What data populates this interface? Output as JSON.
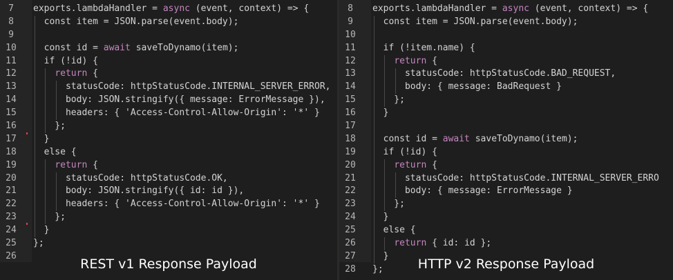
{
  "left": {
    "caption": "REST v1 Response Payload",
    "lines": [
      {
        "n": "7",
        "code": "exports.lambdaHandler = async (event, context) => {"
      },
      {
        "n": "8",
        "code": "  const item = JSON.parse(event.body);"
      },
      {
        "n": "9",
        "code": ""
      },
      {
        "n": "10",
        "code": "  const id = await saveToDynamo(item);"
      },
      {
        "n": "11",
        "code": "  if (!id) {"
      },
      {
        "n": "12",
        "code": "    return {"
      },
      {
        "n": "13",
        "code": "      statusCode: httpStatusCode.INTERNAL_SERVER_ERROR,"
      },
      {
        "n": "14",
        "code": "      body: JSON.stringify({ message: ErrorMessage }),"
      },
      {
        "n": "15",
        "code": "      headers: { 'Access-Control-Allow-Origin': '*' }"
      },
      {
        "n": "16",
        "code": "    };"
      },
      {
        "n": "17",
        "code": "  }"
      },
      {
        "n": "18",
        "code": "  else {"
      },
      {
        "n": "19",
        "code": "    return {"
      },
      {
        "n": "20",
        "code": "      statusCode: httpStatusCode.OK,"
      },
      {
        "n": "21",
        "code": "      body: JSON.stringify({ id: id }),"
      },
      {
        "n": "22",
        "code": "      headers: { 'Access-Control-Allow-Origin': '*' }"
      },
      {
        "n": "23",
        "code": "    };"
      },
      {
        "n": "24",
        "code": "  }"
      },
      {
        "n": "25",
        "code": "};"
      },
      {
        "n": "26",
        "code": ""
      }
    ]
  },
  "right": {
    "caption": "HTTP v2 Response Payload",
    "lines": [
      {
        "n": "8",
        "code": "exports.lambdaHandler = async (event, context) => {"
      },
      {
        "n": "9",
        "code": "  const item = JSON.parse(event.body);"
      },
      {
        "n": "10",
        "code": ""
      },
      {
        "n": "11",
        "code": "  if (!item.name) {"
      },
      {
        "n": "12",
        "code": "    return {"
      },
      {
        "n": "13",
        "code": "      statusCode: httpStatusCode.BAD_REQUEST,"
      },
      {
        "n": "14",
        "code": "      body: { message: BadRequest }"
      },
      {
        "n": "15",
        "code": "    };"
      },
      {
        "n": "16",
        "code": "  }"
      },
      {
        "n": "17",
        "code": ""
      },
      {
        "n": "18",
        "code": "  const id = await saveToDynamo(item);"
      },
      {
        "n": "19",
        "code": "  if (!id) {"
      },
      {
        "n": "20",
        "code": "    return {"
      },
      {
        "n": "21",
        "code": "      statusCode: httpStatusCode.INTERNAL_SERVER_ERRO"
      },
      {
        "n": "22",
        "code": "      body: { message: ErrorMessage }"
      },
      {
        "n": "23",
        "code": "    };"
      },
      {
        "n": "24",
        "code": "  }"
      },
      {
        "n": "25",
        "code": "  else {"
      },
      {
        "n": "26",
        "code": "    return { id: id };"
      },
      {
        "n": "27",
        "code": "  }"
      },
      {
        "n": "28",
        "code": "};"
      }
    ]
  },
  "colors": {
    "background": "#1e1e1e",
    "text": "#d4d4d4",
    "keyword": "#c586c0",
    "line_number": "#b8b8b8"
  }
}
